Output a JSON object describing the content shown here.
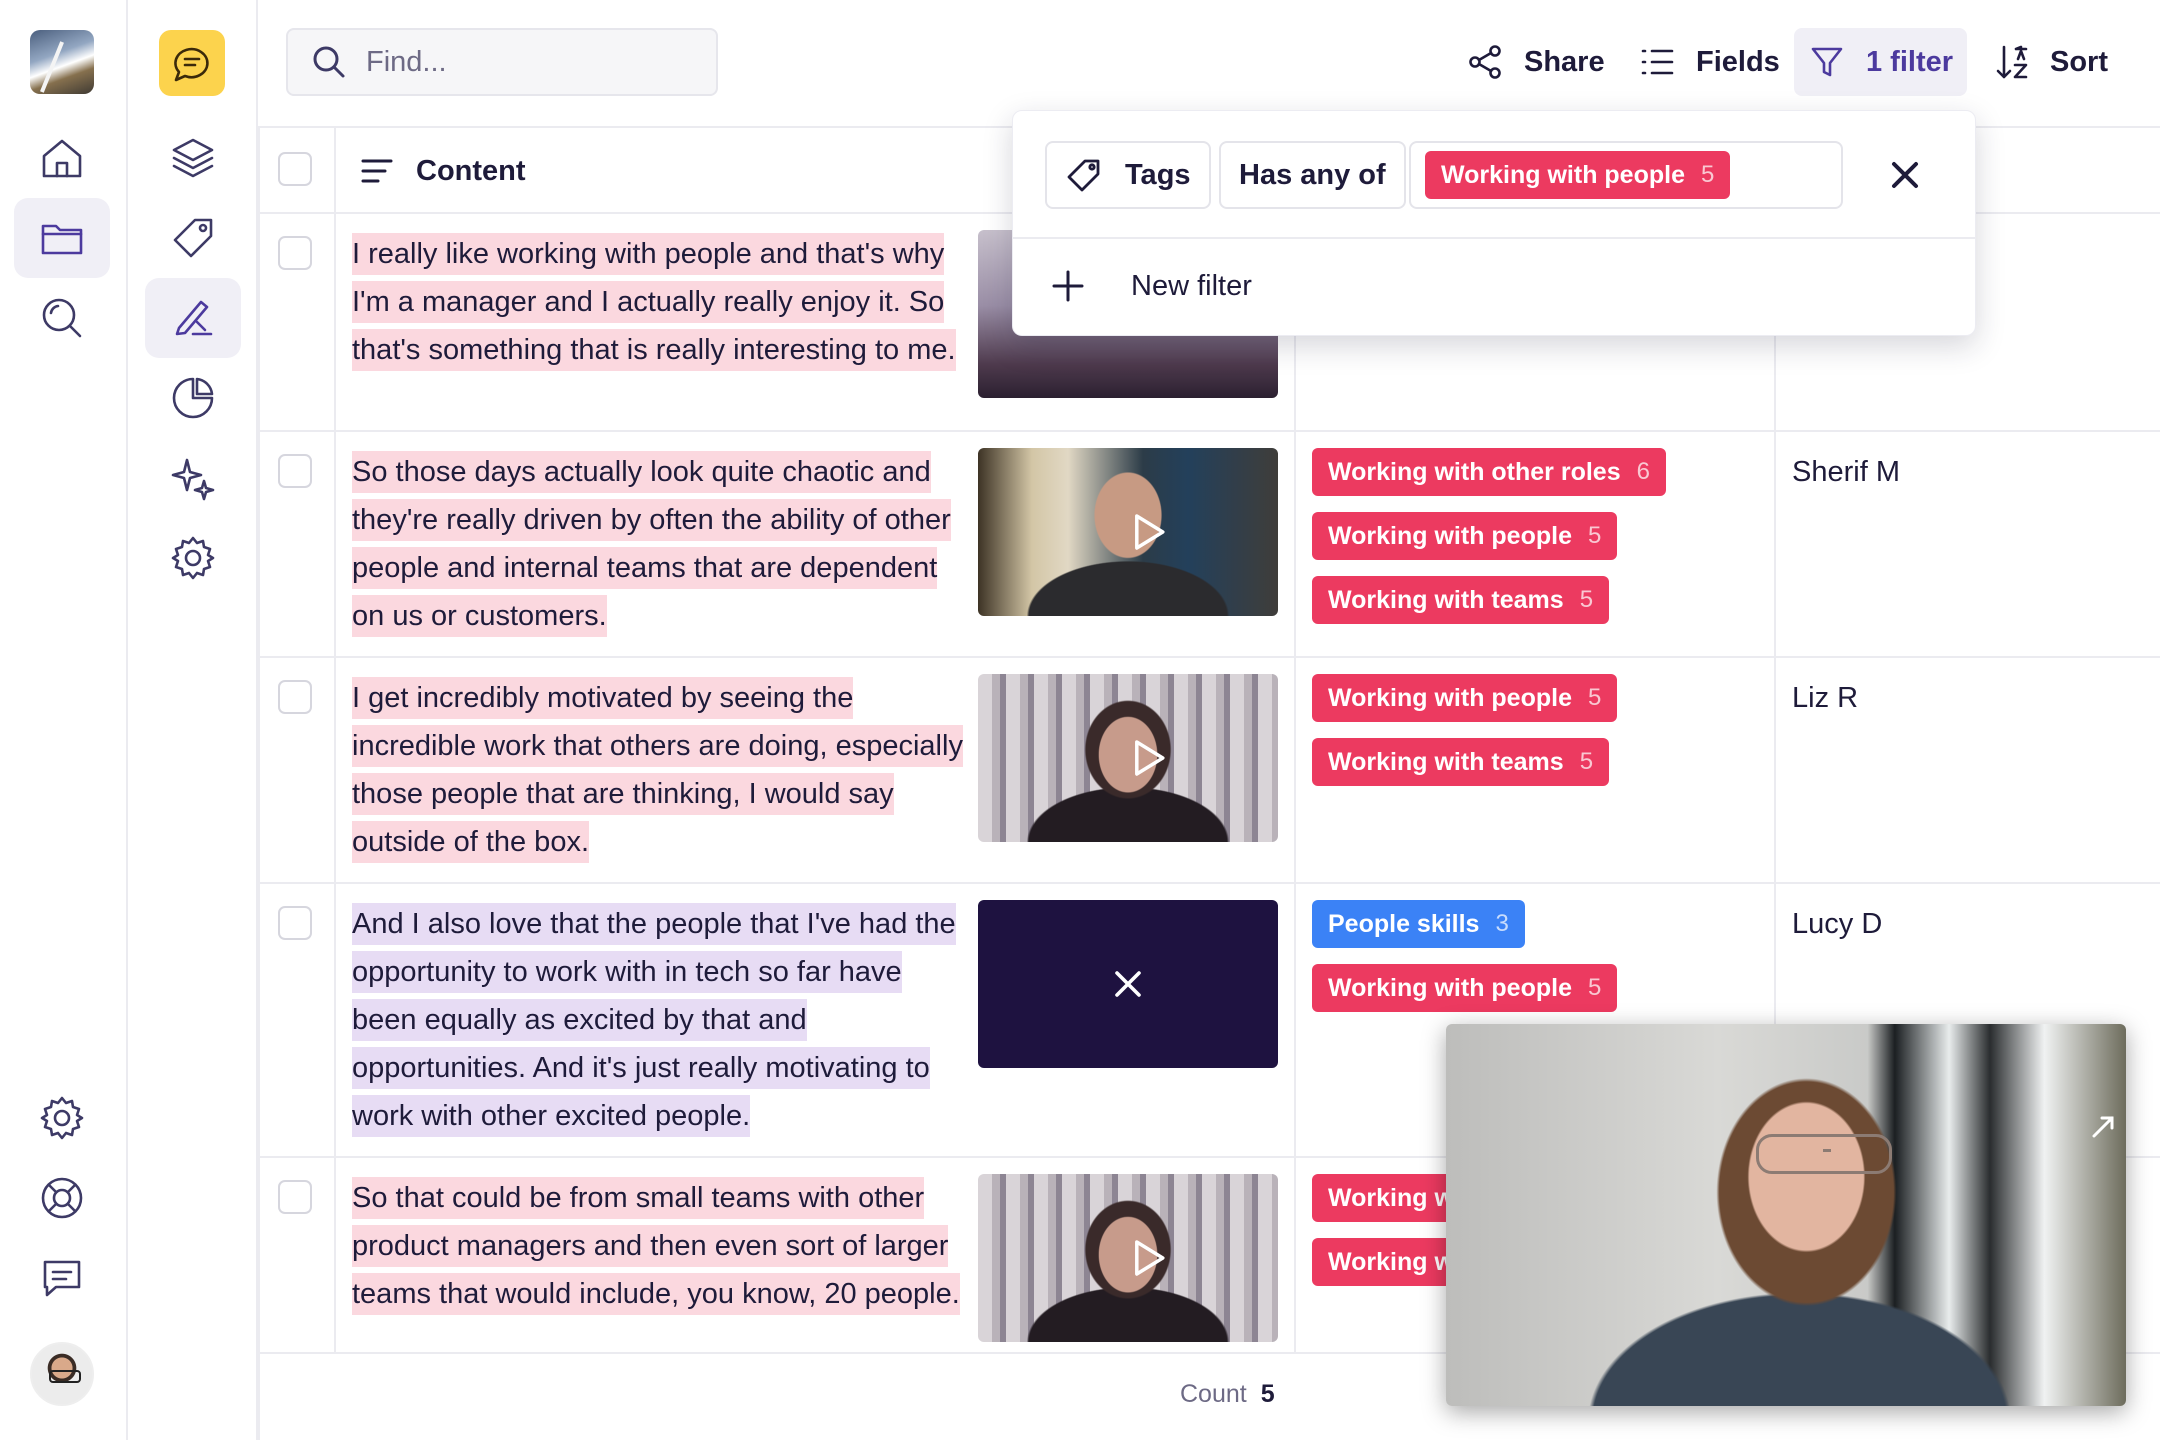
{
  "search": {
    "placeholder": "Find..."
  },
  "toolbar": {
    "share_label": "Share",
    "fields_label": "Fields",
    "filter_label": "1 filter",
    "sort_label": "Sort"
  },
  "table": {
    "header": {
      "content_label": "Content"
    },
    "rows": [
      {
        "quote": "I really like working with people and that's why I'm a manager and I actually really enjoy it. So that's something that is really interesting to me.",
        "tags": [],
        "person": ""
      },
      {
        "quote": "So those days actually look quite chaotic and they're really driven by often the ability of other people and internal teams that are dependent on us or customers.",
        "tags": [
          {
            "label": "Working with other roles",
            "count": "6",
            "color": "#ec3a60"
          },
          {
            "label": "Working with people",
            "count": "5",
            "color": "#ec3a60"
          },
          {
            "label": "Working with teams",
            "count": "5",
            "color": "#ec3a60"
          }
        ],
        "person": "Sherif M"
      },
      {
        "quote": "I get incredibly motivated by seeing the incredible work that others are doing, especially those people that are thinking, I would say outside of the box.",
        "tags": [
          {
            "label": "Working with people",
            "count": "5",
            "color": "#ec3a60"
          },
          {
            "label": "Working with teams",
            "count": "5",
            "color": "#ec3a60"
          }
        ],
        "person": "Liz R"
      },
      {
        "quote": "And I also love that the people that I've had the opportunity to work with in tech so far have been equally as excited by that and opportunities. And it's just really motivating to work with other excited people.",
        "tags": [
          {
            "label": "People skills",
            "count": "3",
            "color": "#3b82f6"
          },
          {
            "label": "Working with people",
            "count": "5",
            "color": "#ec3a60"
          }
        ],
        "person": "Lucy D"
      },
      {
        "quote": "So that could be from small teams with other product managers and then even sort of larger teams that would include, you know, 20 people.",
        "tags": [
          {
            "label": "Working w",
            "count": "",
            "color": "#ec3a60"
          },
          {
            "label": "Working w",
            "count": "",
            "color": "#ec3a60"
          }
        ],
        "person": ""
      }
    ],
    "footer": {
      "count_label": "Count",
      "count_value": "5"
    }
  },
  "filter_popover": {
    "field_label": "Tags",
    "operator_label": "Has any of",
    "value": {
      "label": "Working with people",
      "count": "5"
    },
    "new_filter_label": "New filter"
  },
  "colors": {
    "tag_red": "#ec3a60",
    "tag_blue": "#3b82f6",
    "highlight_pink": "#fbd8df",
    "highlight_purple": "#e7dcf4",
    "accent": "#4c3a9e",
    "chat_badge": "#fcd34d"
  },
  "icons": {
    "rail1": [
      "workspace-logo",
      "home-icon",
      "folder-icon",
      "search-icon",
      "settings-icon",
      "help-icon",
      "feedback-icon",
      "user-avatar"
    ],
    "rail2": [
      "chat-icon",
      "layers-icon",
      "tag-icon",
      "highlight-icon",
      "chart-icon",
      "sparkles-icon",
      "settings-icon"
    ]
  }
}
